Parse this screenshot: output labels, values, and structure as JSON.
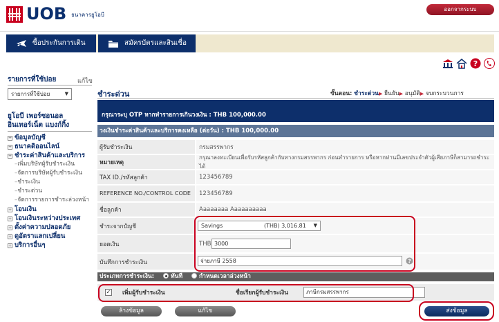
{
  "header": {
    "brand": "UOB",
    "brand_sub": "ธนาคารยูโอบี",
    "logout_label": "ออกจากระบบ"
  },
  "nav": {
    "tabs": [
      {
        "label": "ซื้อประกันการเดินทาง",
        "icon": "airplane-icon"
      },
      {
        "label": "สมัครบัตรและสินเชื่อ",
        "icon": "folder-icon"
      }
    ]
  },
  "utility_icons": [
    "bank-icon",
    "home-icon",
    "help-icon",
    "phone-icon"
  ],
  "sidebar": {
    "favorites_title": "รายการที่ใช้บ่อย",
    "favorites_edit": "แก้ไข",
    "favorites_select": "รายการที่ใช้บ่อย",
    "menu_title_line1": "ยูโอบี เพอร์ซอนอล",
    "menu_title_line2": "อินเทอร์เน็ต แบงก์กิ้ง",
    "items": [
      {
        "label": "ข้อมูลบัญชี",
        "level": "top"
      },
      {
        "label": "ธนาคดิออนไลน์",
        "level": "top"
      },
      {
        "label": "ชำระค่าสินค้าและบริการ",
        "level": "top"
      },
      {
        "label": "เพิ่มบริษัทผู้รับชำระเงิน",
        "level": "sub"
      },
      {
        "label": "จัดการบริษัทผู้รับชำระเงิน",
        "level": "sub"
      },
      {
        "label": "ชำระเงิน",
        "level": "sub"
      },
      {
        "label": "ชำระด่วน",
        "level": "sub"
      },
      {
        "label": "จัดการรายการชำระล่วงหน้า",
        "level": "sub"
      },
      {
        "label": "โอนเงิน",
        "level": "top"
      },
      {
        "label": "โอนเงินระหว่างประเทศ",
        "level": "top"
      },
      {
        "label": "ตั้งค่าความปลอดภัย",
        "level": "top"
      },
      {
        "label": "ดูอัตราแลกเปลี่ยน",
        "level": "top"
      },
      {
        "label": "บริการอื่นๆ",
        "level": "top"
      }
    ]
  },
  "main": {
    "title": "ชำระด่วน",
    "steps_label": "ขั้นตอน:",
    "steps": [
      "ชำระด่วน",
      "ยืนยัน",
      "อนุมัติ",
      "จบกระบวนการ"
    ],
    "otp_notice": "กรุณาระบุ OTP หากทำรายการเกินวงเงิน : THB 100,000.00",
    "limit_notice": "วงเงินชำระค่าสินค้าและบริการคงเหลือ (ต่อวัน) : THB 100,000.00",
    "rows": {
      "payee_label": "ผู้รับชำระเงิน",
      "payee_value": "กรมสรรพากร",
      "note_label": "หมายเหตุ",
      "note_value": "กรุณาลงทะเบียนเพื่อรับรหัสลูกค้ากับทางกรมสรรพากร ก่อนทำรายการ หรือหากท่านมีเลขประจำตัวผู้เสียภาษีก็สามารถชำระได้",
      "taxid_label": "TAX ID./รหัสลูกค้า",
      "taxid_value": "123456789",
      "ref_label": "REFERENCE NO./CONTROL CODE",
      "ref_value": "123456789",
      "customer_label": "ชื่อลูกค้า",
      "customer_value": "Aaaaaaaa Aaaaaaaaaa",
      "from_label": "ชำระจากบัญชี",
      "from_account": "Savings",
      "from_balance": "(THB) 3,016.81",
      "amount_label": "ยอดเงิน",
      "amount_currency": "THB",
      "amount_value": "3000",
      "memo_label": "บันทึกการชำระเงิน",
      "memo_value": "จ่ายภาษี 2558"
    },
    "pay_type_label": "ประเภทการชำระเงิน:",
    "pay_now": "ทันที",
    "pay_later": "กำหนดเวลาล่วงหน้า",
    "add_payee_label": "เพิ่มผู้รับชำระเงิน",
    "payee_name_label": "ชื่อเรียกผู้รับชำระเงิน",
    "payee_name_value": "ภาษีกรมสรรพากร",
    "btn_clear": "ล้างข้อมูล",
    "btn_edit": "แก้ไข",
    "btn_submit": "ส่งข้อมูล"
  },
  "colors": {
    "navy": "#0d2f6b",
    "slate": "#5d7597",
    "uob_red": "#c8001e",
    "highlight": "#c8001e"
  }
}
